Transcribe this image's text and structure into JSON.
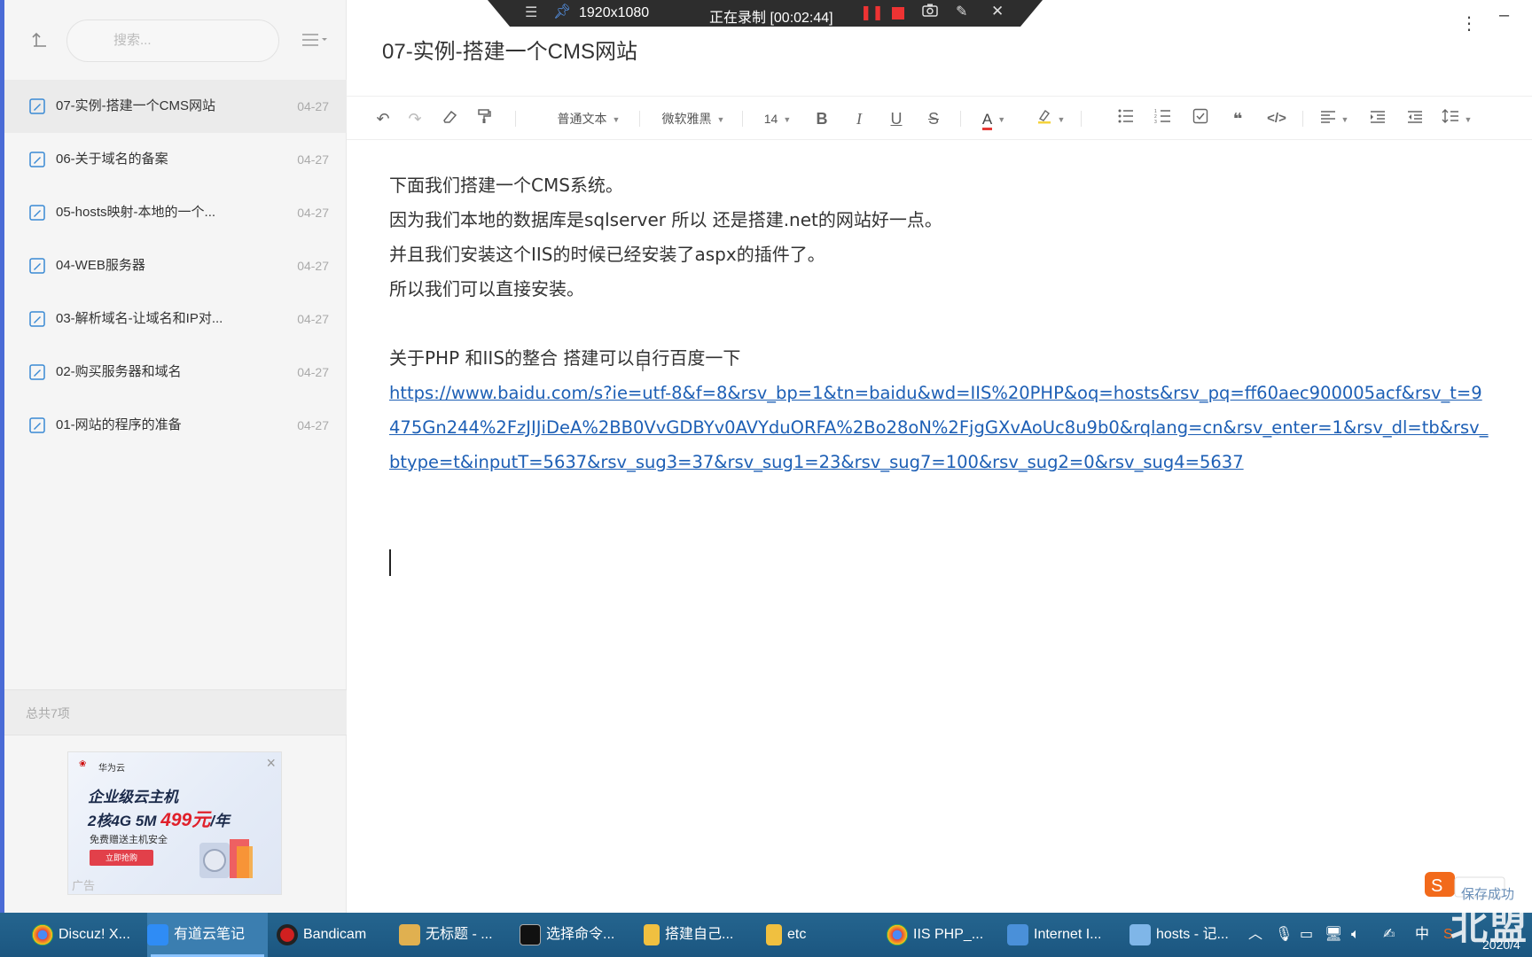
{
  "recorder": {
    "resolution": "1920x1080",
    "status": "正在录制 [00:02:44]"
  },
  "sidebar": {
    "search_placeholder": "搜索...",
    "notes": [
      {
        "title": "07-实例-搭建一个CMS网站",
        "date": "04-27",
        "active": true
      },
      {
        "title": "06-关于域名的备案",
        "date": "04-27"
      },
      {
        "title": "05-hosts映射-本地的一个...",
        "date": "04-27"
      },
      {
        "title": "04-WEB服务器",
        "date": "04-27"
      },
      {
        "title": "03-解析域名-让域名和IP对...",
        "date": "04-27"
      },
      {
        "title": "02-购买服务器和域名",
        "date": "04-27"
      },
      {
        "title": "01-网站的程序的准备",
        "date": "04-27"
      }
    ],
    "total": "总共7项",
    "ad": {
      "brand": "华为云",
      "line1": "企业级云主机",
      "line2_prefix": "2核4G 5M ",
      "line2_price": "499元",
      "line2_suffix": "/年",
      "line3": "免费赠送主机安全",
      "button": "立即抢购",
      "tag": "广告"
    }
  },
  "editor": {
    "title": "07-实例-搭建一个CMS网站",
    "toolbar": {
      "paragraph_style": "普通文本",
      "font_family": "微软雅黑",
      "font_size": "14"
    },
    "lines": [
      "下面我们搭建一个CMS系统。",
      "因为我们本地的数据库是sqlserver 所以 还是搭建.net的网站好一点。",
      "并且我们安装这个IIS的时候已经安装了aspx的插件了。",
      "所以我们可以直接安装。",
      "",
      "关于PHP 和IIS的整合 搭建可以自行百度一下"
    ],
    "link": "https://www.baidu.com/s?ie=utf-8&f=8&rsv_bp=1&tn=baidu&wd=IIS%20PHP&oq=hosts&rsv_pq=ff60aec900005acf&rsv_t=9475Gn244%2FzJIJiDeA%2BB0VvGDBYv0AVYduORFA%2Bo28oN%2FjgGXvAoUc8u9b0&rqlang=cn&rsv_enter=1&rsv_dl=tb&rsv_btype=t&inputT=5637&rsv_sug3=37&rsv_sug1=23&rsv_sug7=100&rsv_sug2=0&rsv_sug4=5637",
    "save_status": "保存成功",
    "ime_label": "中"
  },
  "taskbar": {
    "items": [
      {
        "label": "Discuz! X...",
        "icon": "chrome-icon",
        "color": "#e8453c"
      },
      {
        "label": "有道云笔记",
        "icon": "youdao-note-icon",
        "color": "#2f8cf5",
        "active": true
      },
      {
        "label": "Bandicam",
        "icon": "bandicam-icon",
        "color": "#d02020"
      },
      {
        "label": "无标题 - ...",
        "icon": "paint-icon",
        "color": "#e0b050"
      },
      {
        "label": "选择命令...",
        "icon": "cmd-icon",
        "color": "#111111"
      },
      {
        "label": "搭建自己...",
        "icon": "folder-icon",
        "color": "#f0c040"
      },
      {
        "label": "etc",
        "icon": "folder-icon",
        "color": "#f0c040"
      },
      {
        "label": "IIS PHP_...",
        "icon": "chrome-icon",
        "color": "#e8453c"
      },
      {
        "label": "Internet I...",
        "icon": "iis-manager-icon",
        "color": "#4a90d9"
      },
      {
        "label": "hosts - 记...",
        "icon": "notepad-icon",
        "color": "#7fb6e8"
      }
    ],
    "tray_ime": "中",
    "clock_date": "2020/4",
    "watermark": "北盟"
  }
}
